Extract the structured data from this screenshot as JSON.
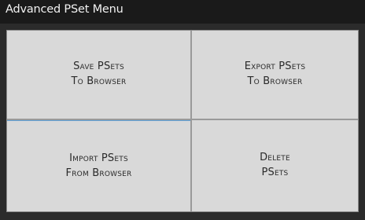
{
  "window": {
    "title": "Advanced PSet Menu"
  },
  "buttons": [
    {
      "line1": "Save PSets",
      "line2": "To Browser"
    },
    {
      "line1": "Export PSets",
      "line2": "To Browser"
    },
    {
      "line1": "Import PSets",
      "line2": "From Browser"
    },
    {
      "line1": "Delete",
      "line2": "PSets"
    }
  ],
  "colors": {
    "background": "#2b2b2b",
    "titlebar": "#1a1a1a",
    "button_face": "#d9d9d9",
    "focus_accent": "#5fa0d6"
  }
}
